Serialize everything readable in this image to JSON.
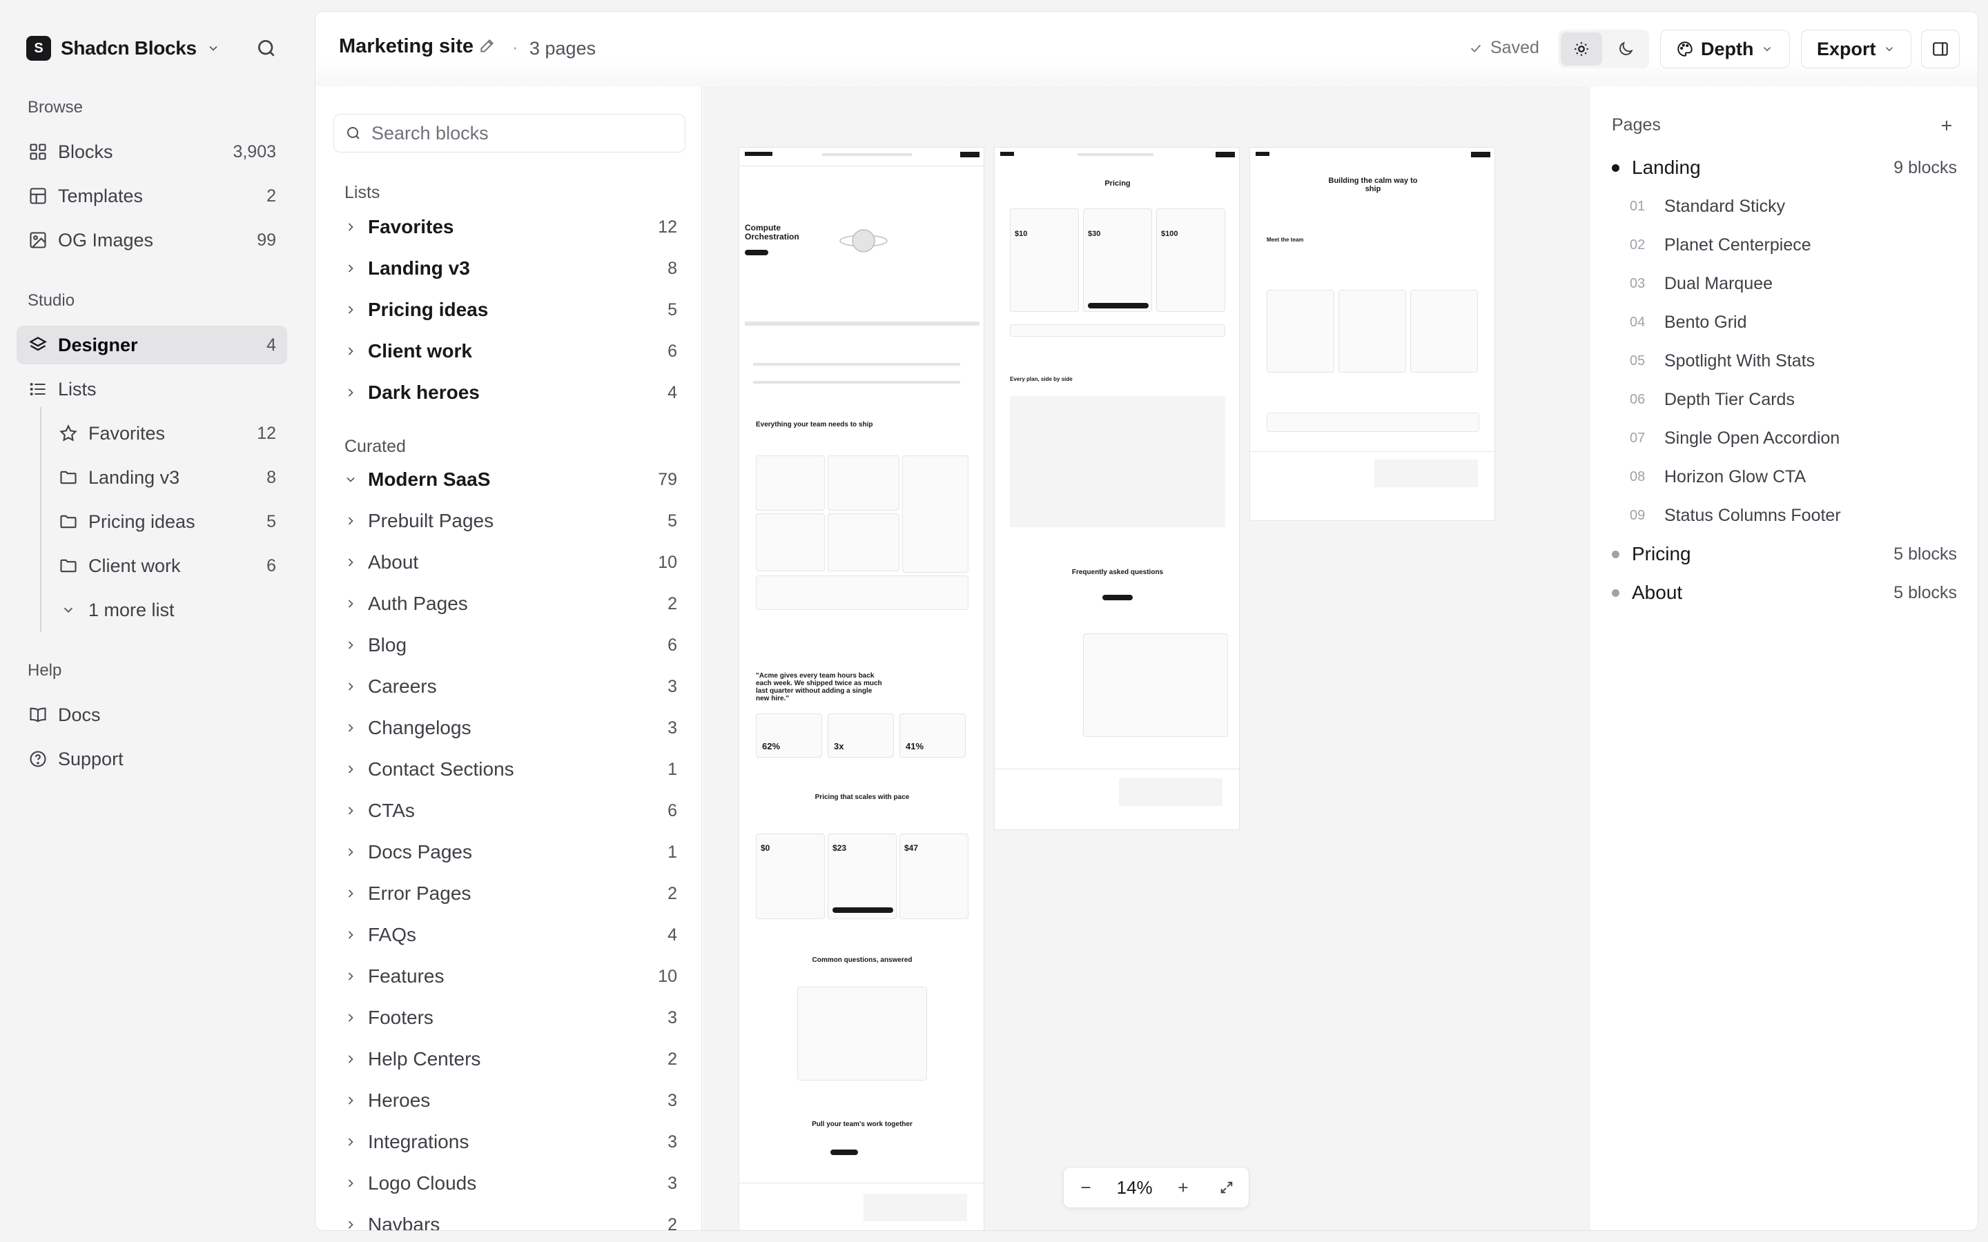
{
  "sidebar": {
    "brand": {
      "logo_letter": "S",
      "name": "Shadcn Blocks"
    },
    "browse_label": "Browse",
    "browse_items": [
      {
        "label": "Blocks",
        "count": "3,903",
        "icon": "grid-icon"
      },
      {
        "label": "Templates",
        "count": "2",
        "icon": "layout-icon"
      },
      {
        "label": "OG Images",
        "count": "99",
        "icon": "image-icon"
      }
    ],
    "studio_label": "Studio",
    "studio_items": [
      {
        "label": "Designer",
        "count": "4",
        "icon": "layers-icon",
        "active": true
      },
      {
        "label": "Lists",
        "count": "",
        "icon": "list-icon"
      }
    ],
    "lists": [
      {
        "label": "Favorites",
        "count": "12",
        "icon": "star-icon"
      },
      {
        "label": "Landing v3",
        "count": "8",
        "icon": "folder-icon"
      },
      {
        "label": "Pricing ideas",
        "count": "5",
        "icon": "folder-icon"
      },
      {
        "label": "Client work",
        "count": "6",
        "icon": "folder-icon"
      }
    ],
    "more_lists": "1 more list",
    "help_label": "Help",
    "help_items": [
      {
        "label": "Docs",
        "icon": "book-icon"
      },
      {
        "label": "Support",
        "icon": "help-circle-icon"
      }
    ]
  },
  "topbar": {
    "title": "Marketing site",
    "separator": "·",
    "page_count": "3 pages",
    "saved": "Saved",
    "depth_label": "Depth",
    "export_label": "Export"
  },
  "browser": {
    "search_placeholder": "Search blocks",
    "lists_label": "Lists",
    "lists": [
      {
        "label": "Favorites",
        "count": "12"
      },
      {
        "label": "Landing v3",
        "count": "8"
      },
      {
        "label": "Pricing ideas",
        "count": "5"
      },
      {
        "label": "Client work",
        "count": "6"
      },
      {
        "label": "Dark heroes",
        "count": "4"
      }
    ],
    "curated_label": "Curated",
    "curated": [
      {
        "label": "Modern SaaS",
        "count": "79",
        "expanded": true
      },
      {
        "label": "Prebuilt Pages",
        "count": "5"
      },
      {
        "label": "About",
        "count": "10"
      },
      {
        "label": "Auth Pages",
        "count": "2"
      },
      {
        "label": "Blog",
        "count": "6"
      },
      {
        "label": "Careers",
        "count": "3"
      },
      {
        "label": "Changelogs",
        "count": "3"
      },
      {
        "label": "Contact Sections",
        "count": "1"
      },
      {
        "label": "CTAs",
        "count": "6"
      },
      {
        "label": "Docs Pages",
        "count": "1"
      },
      {
        "label": "Error Pages",
        "count": "2"
      },
      {
        "label": "FAQs",
        "count": "4"
      },
      {
        "label": "Features",
        "count": "10"
      },
      {
        "label": "Footers",
        "count": "3"
      },
      {
        "label": "Help Centers",
        "count": "2"
      },
      {
        "label": "Heroes",
        "count": "3"
      },
      {
        "label": "Integrations",
        "count": "3"
      },
      {
        "label": "Logo Clouds",
        "count": "3"
      },
      {
        "label": "Navbars",
        "count": "2"
      }
    ]
  },
  "canvas": {
    "zoom": "14%",
    "landing": {
      "hero": "Compute Orchestration",
      "features": "Everything your team needs to ship",
      "quote": "\"Acme gives every team hours back each week. We shipped twice as much last quarter without adding a single new hire.\"",
      "stats": [
        "62%",
        "3x",
        "41%"
      ],
      "pricing": "Pricing that scales with pace",
      "prices": [
        "$0",
        "$23",
        "$47"
      ],
      "faq": "Common questions, answered",
      "cta": "Pull your team's work together"
    },
    "pricing": {
      "title": "Pricing",
      "prices": [
        "$10",
        "$30",
        "$100"
      ],
      "compare": "Every plan, side by side",
      "faq": "Frequently asked questions"
    },
    "about": {
      "title": "Building the calm way to ship",
      "team": "Meet the team"
    }
  },
  "pages": {
    "label": "Pages",
    "items": [
      {
        "label": "Landing",
        "count": "9 blocks",
        "active": true
      },
      {
        "label": "Pricing",
        "count": "5 blocks"
      },
      {
        "label": "About",
        "count": "5 blocks"
      }
    ],
    "landing_blocks": [
      {
        "num": "01",
        "label": "Standard Sticky"
      },
      {
        "num": "02",
        "label": "Planet Centerpiece"
      },
      {
        "num": "03",
        "label": "Dual Marquee"
      },
      {
        "num": "04",
        "label": "Bento Grid"
      },
      {
        "num": "05",
        "label": "Spotlight With Stats"
      },
      {
        "num": "06",
        "label": "Depth Tier Cards"
      },
      {
        "num": "07",
        "label": "Single Open Accordion"
      },
      {
        "num": "08",
        "label": "Horizon Glow CTA"
      },
      {
        "num": "09",
        "label": "Status Columns Footer"
      }
    ]
  }
}
